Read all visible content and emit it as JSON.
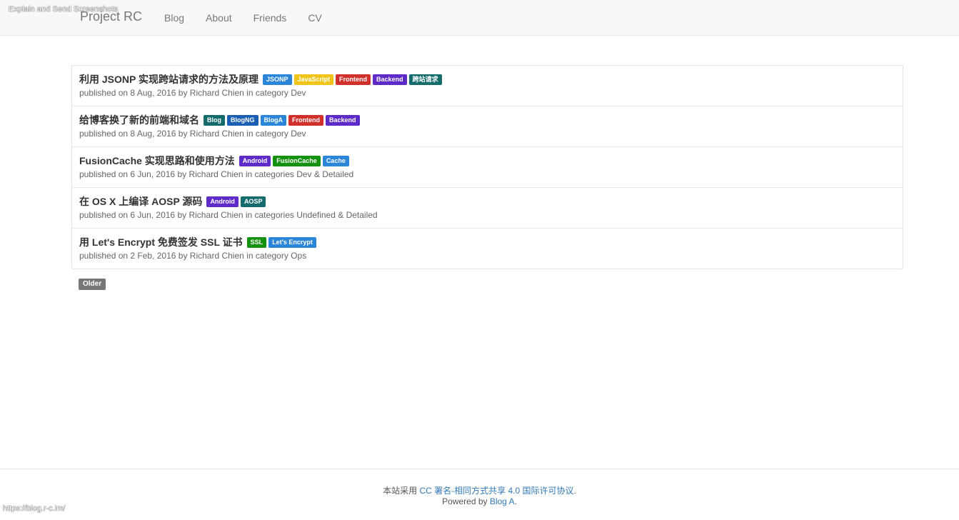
{
  "overlay": {
    "top_text": "Explain and Send Screenshots",
    "bottom_url": "https://blog.r-c.im/"
  },
  "navbar": {
    "brand": "Project RC",
    "links": [
      "Blog",
      "About",
      "Friends",
      "CV"
    ]
  },
  "posts": [
    {
      "title": "利用 JSONP 实现跨站请求的方法及原理",
      "tags": [
        {
          "label": "JSONP",
          "color": "#2b86d9"
        },
        {
          "label": "JavaScript",
          "color": "#f0c419"
        },
        {
          "label": "Frontend",
          "color": "#d0312d"
        },
        {
          "label": "Backend",
          "color": "#5e2bc9"
        },
        {
          "label": "跨站请求",
          "color": "#146b6b"
        }
      ],
      "meta": "published on 8 Aug, 2016 by Richard Chien in category Dev"
    },
    {
      "title": "给博客换了新的前端和域名",
      "tags": [
        {
          "label": "Blog",
          "color": "#146b6b"
        },
        {
          "label": "BlogNG",
          "color": "#1a5fb4"
        },
        {
          "label": "BlogA",
          "color": "#2b86d9"
        },
        {
          "label": "Frontend",
          "color": "#d0312d"
        },
        {
          "label": "Backend",
          "color": "#5e2bc9"
        }
      ],
      "meta": "published on 8 Aug, 2016 by Richard Chien in category Dev"
    },
    {
      "title": "FusionCache 实现思路和使用方法",
      "tags": [
        {
          "label": "Android",
          "color": "#5e2bc9"
        },
        {
          "label": "FusionCache",
          "color": "#14910f"
        },
        {
          "label": "Cache",
          "color": "#2b86d9"
        }
      ],
      "meta": "published on 6 Jun, 2016 by Richard Chien in categories Dev & Detailed"
    },
    {
      "title": "在 OS X 上编译 AOSP 源码",
      "tags": [
        {
          "label": "Android",
          "color": "#5e2bc9"
        },
        {
          "label": "AOSP",
          "color": "#146b6b"
        }
      ],
      "meta": "published on 6 Jun, 2016 by Richard Chien in categories Undefined & Detailed"
    },
    {
      "title": "用 Let's Encrypt 免费签发 SSL 证书",
      "tags": [
        {
          "label": "SSL",
          "color": "#14910f"
        },
        {
          "label": "Let's Encrypt",
          "color": "#2b86d9"
        }
      ],
      "meta": "published on 2 Feb, 2016 by Richard Chien in category Ops"
    }
  ],
  "pagination": {
    "older_label": "Older"
  },
  "footer": {
    "line1_prefix": "本站采用 ",
    "license_link": "CC 署名-相同方式共享 4.0 国际许可协议",
    "line1_suffix": ".",
    "line2_prefix": "Powered by ",
    "powered_link": "Blog A",
    "line2_suffix": "."
  }
}
